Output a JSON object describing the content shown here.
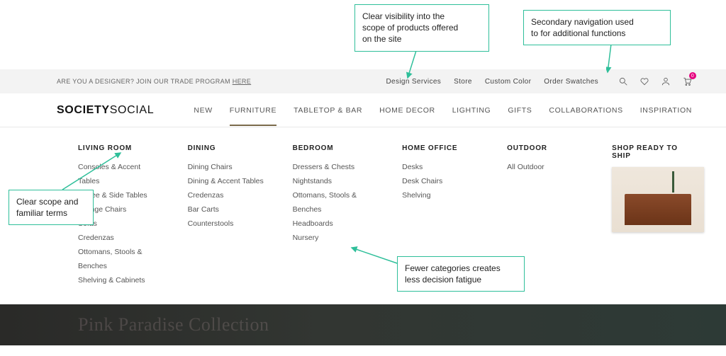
{
  "callouts": {
    "scope_visibility": "Clear visibility into the\nscope of products offered\non the site",
    "secondary_nav": "Secondary navigation used\nto for additional functions",
    "familiar_terms": "Clear scope and\nfamiliar terms",
    "fewer_categories": "Fewer categories creates\nless decision fatigue"
  },
  "topbar": {
    "trade_prefix": "ARE YOU A DESIGNER? JOIN OUR TRADE PROGRAM ",
    "trade_link": "HERE",
    "secondary": [
      "Design Services",
      "Store",
      "Custom Color",
      "Order Swatches"
    ],
    "cart_badge": "0"
  },
  "logo": {
    "bold": "SOCIETY",
    "light": "SOCIAL"
  },
  "primary_nav": [
    "NEW",
    "FURNITURE",
    "TABLETOP & BAR",
    "HOME DECOR",
    "LIGHTING",
    "GIFTS",
    "COLLABORATIONS",
    "INSPIRATION"
  ],
  "primary_nav_active_index": 1,
  "mega": {
    "columns": [
      {
        "heading": "LIVING ROOM",
        "items": [
          "Consoles & Accent Tables",
          "Coffee & Side Tables",
          "Lounge Chairs",
          "Sofas",
          "Credenzas",
          "Ottomans, Stools & Benches",
          "Shelving & Cabinets"
        ]
      },
      {
        "heading": "DINING",
        "items": [
          "Dining Chairs",
          "Dining & Accent Tables",
          "Credenzas",
          "Bar Carts",
          "Counterstools"
        ]
      },
      {
        "heading": "BEDROOM",
        "items": [
          "Dressers & Chests",
          "Nightstands",
          "Ottomans, Stools & Benches",
          "Headboards",
          "Nursery"
        ]
      },
      {
        "heading": "HOME OFFICE",
        "items": [
          "Desks",
          "Desk Chairs",
          "Shelving"
        ]
      },
      {
        "heading": "OUTDOOR",
        "items": [
          "All Outdoor"
        ]
      }
    ],
    "ship_heading": "SHOP READY TO SHIP"
  },
  "hero": {
    "headline": "Pink Paradise Collection"
  }
}
